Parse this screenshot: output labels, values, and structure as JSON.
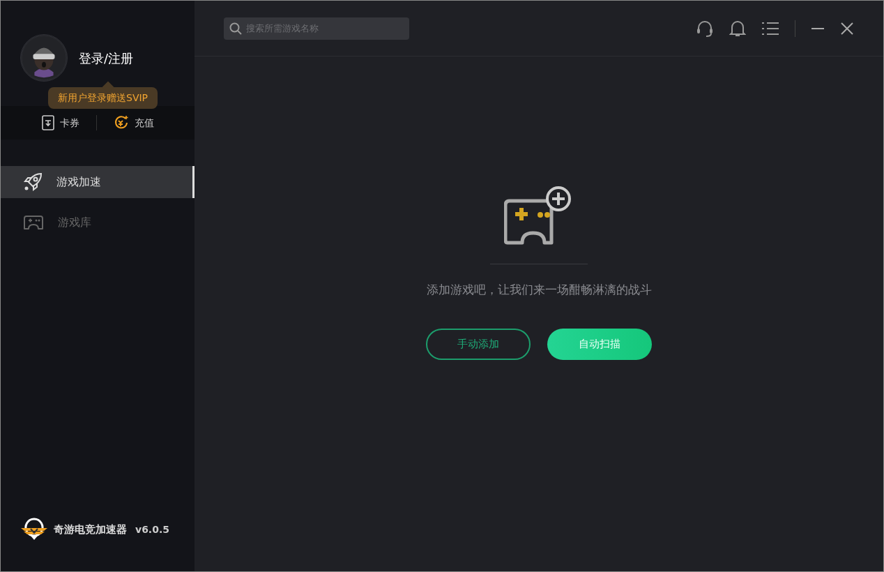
{
  "user": {
    "login_label": "登录/注册",
    "promo_tip": "新用户登录赠送SVIP"
  },
  "quick_actions": [
    {
      "label": "卡券",
      "kind": "coupon"
    },
    {
      "label": "充值",
      "kind": "recharge"
    }
  ],
  "sidebar": {
    "items": [
      {
        "label": "游戏加速",
        "kind": "rocket",
        "selected": true
      },
      {
        "label": "游戏库",
        "kind": "gamepad",
        "selected": false
      }
    ]
  },
  "brand": {
    "name": "奇游电竞加速器",
    "version": "v6.0.5"
  },
  "search": {
    "placeholder": "搜索所需游戏名称"
  },
  "empty_state": {
    "message": "添加游戏吧，让我们来一场酣畅淋漓的战斗"
  },
  "buttons": [
    {
      "label": "手动添加",
      "kind": "outline"
    },
    {
      "label": "自动扫描",
      "kind": "primary"
    }
  ]
}
